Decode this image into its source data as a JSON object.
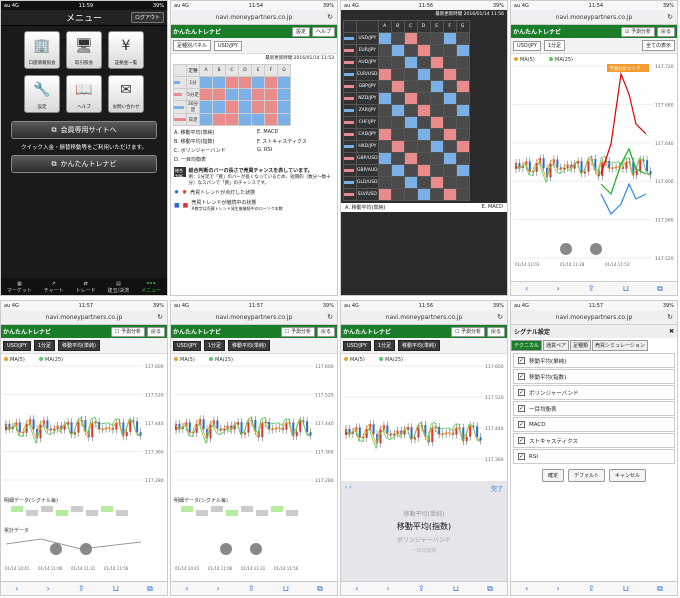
{
  "status": {
    "left": "au 4G",
    "t1": "11:59",
    "t2": "11:54",
    "t3": "11:56",
    "t4": "11:54",
    "t5": "11:57",
    "t6": "11:57",
    "t7": "11:56",
    "t8": "11:57",
    "batt": "39%"
  },
  "url": "navi.moneypartners.co.jp",
  "brand": "かんたんトレナビ",
  "menu": {
    "title": "メニュー",
    "logout": "ログアウト",
    "tiles": [
      {
        "icon": "🏢",
        "label": "口座情報照会"
      },
      {
        "icon": "🖥",
        "label": "取引照会"
      },
      {
        "icon": "¥",
        "label": "証拠金一覧"
      },
      {
        "icon": "🔧",
        "label": "設定"
      },
      {
        "icon": "📖",
        "label": "ヘルプ"
      },
      {
        "icon": "✉",
        "label": "お問い合わせ"
      }
    ],
    "member_site": "会員専用サイトへ",
    "note": "クイック入金・振替移動等をご利用いただけます。",
    "trenavi": "かんたんトレナビ",
    "tabs": [
      "マーケット",
      "チャート",
      "トレード",
      "建玉/決済",
      "メニュー"
    ]
  },
  "p2": {
    "setting": "設定",
    "help": "ヘルプ",
    "panel": "足種別パネル",
    "pair": "USD/JPY",
    "updated": "最新更新時間 2016/01/14 11:53",
    "cols": [
      "",
      "定種",
      "A",
      "B",
      "C",
      "D",
      "E",
      "F",
      "G"
    ],
    "rows": [
      "1分",
      "5分足",
      "30分足",
      "日足"
    ],
    "legend": [
      "A. 移動平均(単純)",
      "B. 移動平均(指数)",
      "C. ボリンジャーバンド",
      "D. 一目均衡表",
      "E. MACD",
      "F. ストキャスティクス",
      "G. RSI"
    ],
    "desc1": "総合判断のバーの長さで売買チャンスを表しています。",
    "desc2": "例：1分足で「買」のバーが長くなっているため、短期的（数分〜数十分）なスパンで「買」のチャンスです。",
    "sig1": "売買トレンドが点灯した状態",
    "sig2": "売買トレンドが継続中の状態",
    "sig2b": "※数字は売買トレンド発生後継続中のローソク本数"
  },
  "p3": {
    "updated": "最新更新時間 2016/01/14 11:56",
    "pairs": [
      "USD/JPY",
      "EUR/JPY",
      "AUD/JPY",
      "EUR/USD",
      "GBP/JPY",
      "NZD/JPY",
      "ZAR/JPY",
      "CHF/JPY",
      "CAD/JPY",
      "HKD/JPY",
      "GBP/USD",
      "GBP/AUD",
      "GLD/USD",
      "SLV/USD"
    ],
    "footer": "A. 移動平均(単純)",
    "footer2": "E. MACD"
  },
  "chart": {
    "pair": "USD/JPY",
    "tf": "1分足",
    "ind": "移動平均(単純)",
    "all": "全ての表示",
    "predict": "予測分析",
    "back": "戻る",
    "ma5": "MA(5)",
    "ma25": "MA(25)",
    "area": "予測分析エリア",
    "sub1": "明細データ(シグナル毎)",
    "sub2": "累計データ",
    "done": "完了",
    "y1": [
      "117.720",
      "117.680",
      "117.640",
      "117.600",
      "117.560",
      "117.520"
    ],
    "y2": [
      "117.600",
      "117.520",
      "117.440",
      "117.360",
      "117.280"
    ],
    "x4": [
      "01/14 11:03",
      "01/14 11:28",
      "01/14 11:53"
    ],
    "x5": [
      "01/14 10:41",
      "01/14 11:06",
      "01/14 11:31",
      "01/14 11:56"
    ]
  },
  "picker": [
    "移動平均(単純)",
    "移動平均(指数)",
    "ボリンジャーバンド",
    "一目均衡表"
  ],
  "signal": {
    "title": "シグナル設定",
    "tabs": [
      "テクニカル",
      "通貨ペア",
      "足種類",
      "売買シミュレーション"
    ],
    "items": [
      "移動平均(単純)",
      "移動平均(指数)",
      "ボリンジャーバンド",
      "一目均衡表",
      "MACD",
      "ストキャスティクス",
      "RSI"
    ],
    "ok": "確定",
    "def": "デフォルト",
    "cancel": "キャンセル"
  },
  "colors": {
    "green": "#1b7d2a",
    "buy": "#7ab0e6",
    "sell": "#e98b8b"
  }
}
